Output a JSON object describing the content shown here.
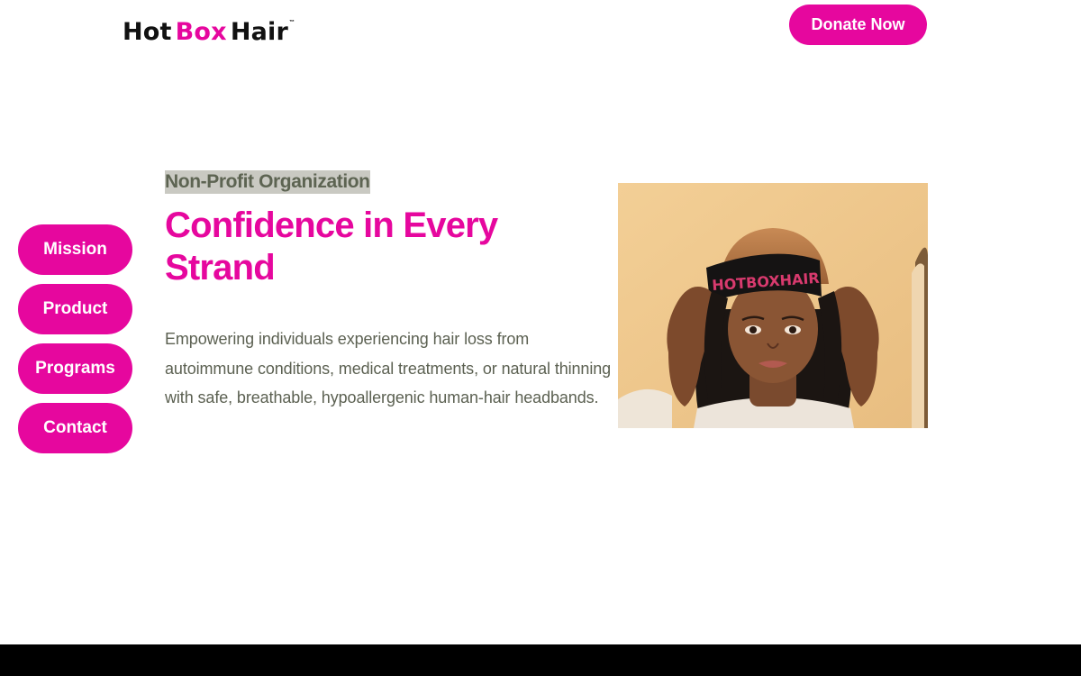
{
  "header": {
    "logo": {
      "part1": "Hot",
      "part2": "Box",
      "part3": "Hair",
      "trademark": "™"
    },
    "donate_label": "Donate Now"
  },
  "side_nav": {
    "items": [
      {
        "label": "Mission"
      },
      {
        "label": "Product"
      },
      {
        "label": "Programs"
      },
      {
        "label": "Contact"
      }
    ]
  },
  "hero": {
    "eyebrow": "Non-Profit Organization",
    "title": "Confidence in Every Strand",
    "description": "Empowering individuals experiencing hair loss from autoimmune conditions, medical treatments, or natural thinning with safe, breathable, hypoallergenic human-hair headbands.",
    "image": {
      "headband_text": "HOTBOXHAIR"
    }
  },
  "colors": {
    "accent": "#e6079e",
    "text_muted": "#5c6152",
    "eyebrow_bg": "#c9c9c2",
    "footer": "#000000"
  }
}
